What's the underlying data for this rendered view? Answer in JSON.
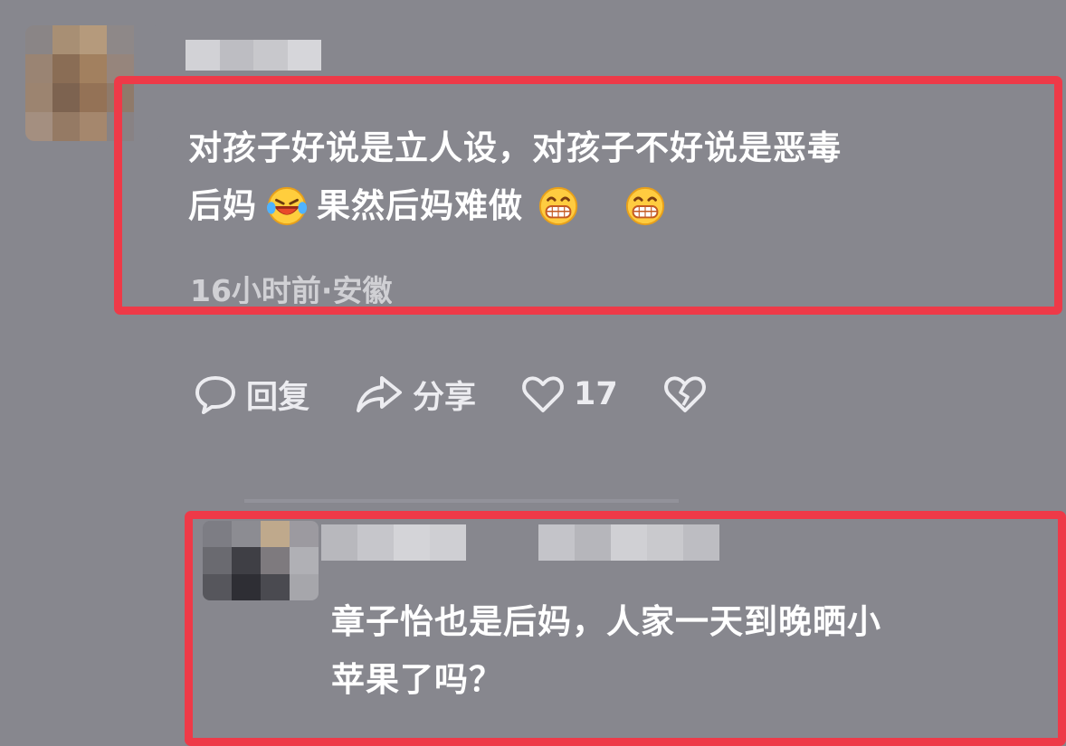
{
  "comment": {
    "text_line1": "对孩子好说是立人设，对孩子不好说是恶毒",
    "text_line2a": "后妈",
    "text_line2b": "果然后妈难做",
    "meta": "16小时前·安徽",
    "icons": [
      "laugh-cry-emoji",
      "grin-emoji",
      "grin-emoji"
    ]
  },
  "actions": {
    "reply_label": "回复",
    "share_label": "分享",
    "like_count": "17",
    "icons": [
      "comment-bubble-icon",
      "share-arrow-icon",
      "heart-icon",
      "broken-heart-icon"
    ]
  },
  "reply": {
    "text_line1": "章子怡也是后妈，人家一天到晚晒小",
    "text_line2": "苹果了吗？"
  },
  "colors": {
    "background": "#87878e",
    "highlight": "#ee3a48",
    "text": "#ffffff"
  }
}
